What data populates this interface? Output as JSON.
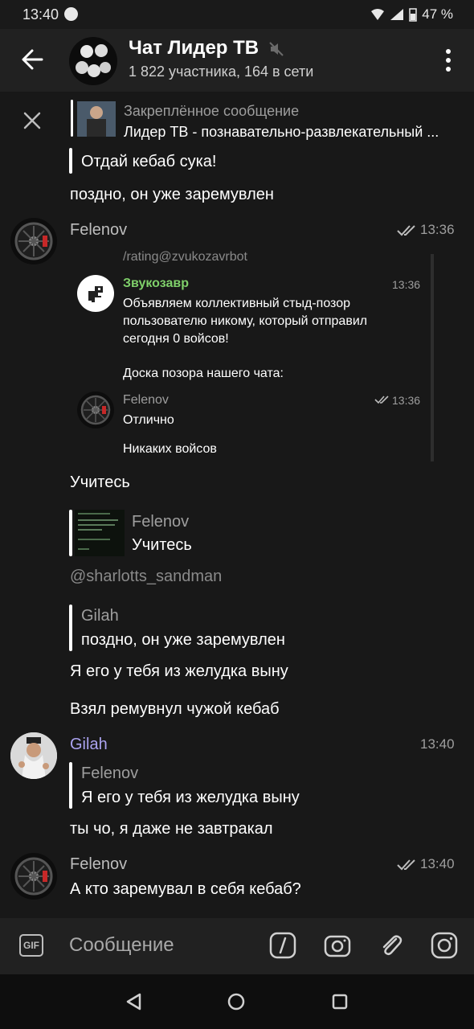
{
  "status": {
    "time": "13:40",
    "battery": "47 %"
  },
  "header": {
    "title": "Чат Лидер ТВ",
    "subtitle": "1 822 участника, 164 в сети"
  },
  "pinned": {
    "title": "Закреплённое сообщение",
    "text": "Лидер ТВ - познавательно-развлекательный ..."
  },
  "messages": {
    "m1_reply": "Отдай кебаб сука!",
    "m1_text": "поздно, он уже заремувлен",
    "m2_sender": "Felenov",
    "m2_time": "13:36",
    "m2_cmd": "/rating@zvukozavrbot",
    "m2_bot_name": "Звукозавр",
    "m2_bot_time": "13:36",
    "m2_bot_line1": "Объявляем коллективный стыд-позор",
    "m2_bot_line2": "пользователю никому, который отправил",
    "m2_bot_line3": "сегодня 0 войсов!",
    "m2_bot_line4": "Доска позора нашего чата:",
    "m2_inner_name": "Felenov",
    "m2_inner_time": "13:36",
    "m2_inner_text1": "Отлично",
    "m2_inner_text2": "Никаких войсов",
    "m2_text": "Учитесь",
    "m3_reply_name": "Felenov",
    "m3_reply_text": "Учитесь",
    "m3_text": "@sharlotts_sandman",
    "m4_reply_name": "Gilah",
    "m4_reply_text": "поздно, он уже заремувлен",
    "m4_text": "Я его у тебя из желудка выну",
    "m5_text": "Взял ремувнул чужой кебаб",
    "m6_sender": "Gilah",
    "m6_time": "13:40",
    "m6_reply_name": "Felenov",
    "m6_reply_text": "Я его у тебя из желудка выну",
    "m6_text": "ты чо, я даже не завтракал",
    "m7_sender": "Felenov",
    "m7_time": "13:40",
    "m7_text": "А кто заремувал в себя кебаб?"
  },
  "input": {
    "placeholder": "Сообщение",
    "gif_label": "GIF"
  },
  "colors": {
    "accent_gilah": "#aba3f0",
    "bot_green": "#7fd06a"
  }
}
